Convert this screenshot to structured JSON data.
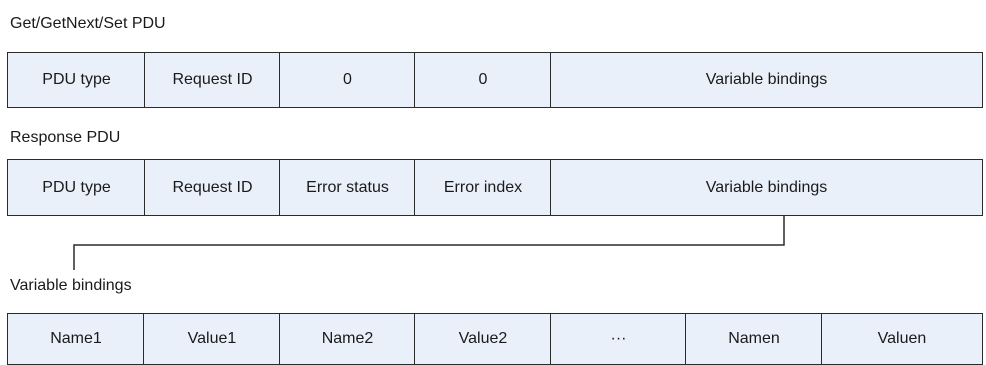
{
  "sections": {
    "request": {
      "caption": "Get/GetNext/Set PDU",
      "fields": [
        "PDU type",
        "Request ID",
        "0",
        "0",
        "Variable bindings"
      ]
    },
    "response": {
      "caption": "Response PDU",
      "fields": [
        "PDU type",
        "Request ID",
        "Error status",
        "Error index",
        "Variable bindings"
      ]
    },
    "bindings": {
      "caption": "Variable bindings",
      "fields": [
        "Name1",
        "Value1",
        "Name2",
        "Value2",
        "···",
        "Namen",
        "Valuen"
      ]
    }
  },
  "colors": {
    "cell_fill": "#eaf0fa",
    "cell_border": "#2b2b2b",
    "connector": "#2b2b2b"
  }
}
